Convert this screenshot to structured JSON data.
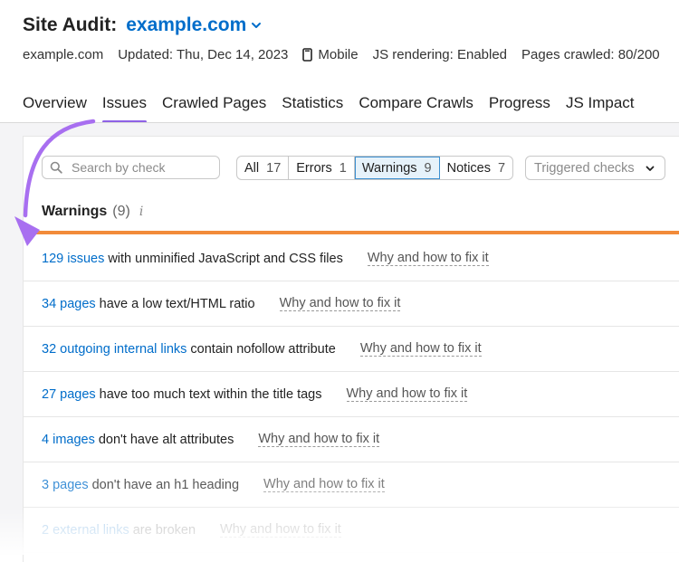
{
  "header": {
    "title": "Site Audit:",
    "domain": "example.com",
    "meta": {
      "domain": "example.com",
      "updated": "Updated: Thu, Dec 14, 2023",
      "device": "Mobile",
      "js_rendering": "JS rendering: Enabled",
      "pages_crawled": "Pages crawled: 80/200"
    },
    "tabs": [
      "Overview",
      "Issues",
      "Crawled Pages",
      "Statistics",
      "Compare Crawls",
      "Progress",
      "JS Impact"
    ],
    "active_tab": "Issues"
  },
  "filters": {
    "search_placeholder": "Search by check",
    "segments": [
      {
        "label": "All",
        "count": "17"
      },
      {
        "label": "Errors",
        "count": "1"
      },
      {
        "label": "Warnings",
        "count": "9"
      },
      {
        "label": "Notices",
        "count": "7"
      }
    ],
    "active_segment": "Warnings",
    "triggered_checks": "Triggered checks"
  },
  "section": {
    "title": "Warnings",
    "count": "(9)",
    "info": "i"
  },
  "issues": [
    {
      "link": "129 issues",
      "text": "with unminified JavaScript and CSS files",
      "why": "Why and how to fix it"
    },
    {
      "link": "34 pages",
      "text": "have a low text/HTML ratio",
      "why": "Why and how to fix it"
    },
    {
      "link": "32 outgoing internal links",
      "text": "contain nofollow attribute",
      "why": "Why and how to fix it"
    },
    {
      "link": "27 pages",
      "text": "have too much text within the title tags",
      "why": "Why and how to fix it"
    },
    {
      "link": "4 images",
      "text": "don't have alt attributes",
      "why": "Why and how to fix it"
    },
    {
      "link": "3 pages",
      "text": "don't have an h1 heading",
      "why": "Why and how to fix it"
    },
    {
      "link": "2 external links",
      "text": "are broken",
      "why": "Why and how to fix it"
    }
  ],
  "colors": {
    "accent_blue": "#006dca",
    "tab_underline": "#8e61e6",
    "warnings_bar": "#f28b3a",
    "annotation_arrow": "#a86ff0"
  }
}
